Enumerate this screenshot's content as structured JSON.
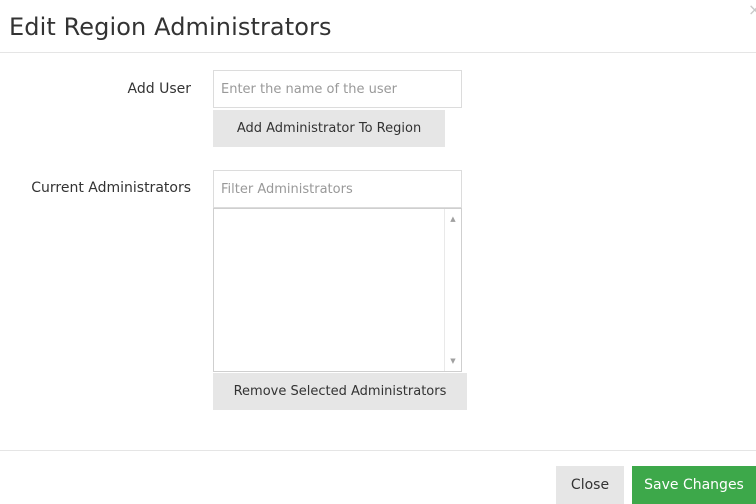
{
  "header": {
    "title": "Edit Region Administrators",
    "close_glyph": "×"
  },
  "form": {
    "add_user": {
      "label": "Add User",
      "placeholder": "Enter the name of the user",
      "value": "",
      "button_label": "Add Administrator To Region"
    },
    "current_admins": {
      "label": "Current Administrators",
      "filter_placeholder": "Filter Administrators",
      "filter_value": "",
      "items": [],
      "remove_button_label": "Remove Selected Administrators"
    }
  },
  "scrollbar": {
    "up_glyph": "▲",
    "down_glyph": "▼"
  },
  "footer": {
    "close_label": "Close",
    "save_label": "Save Changes"
  },
  "colors": {
    "save_button": "#3da84a",
    "secondary_button": "#e6e6e6"
  }
}
